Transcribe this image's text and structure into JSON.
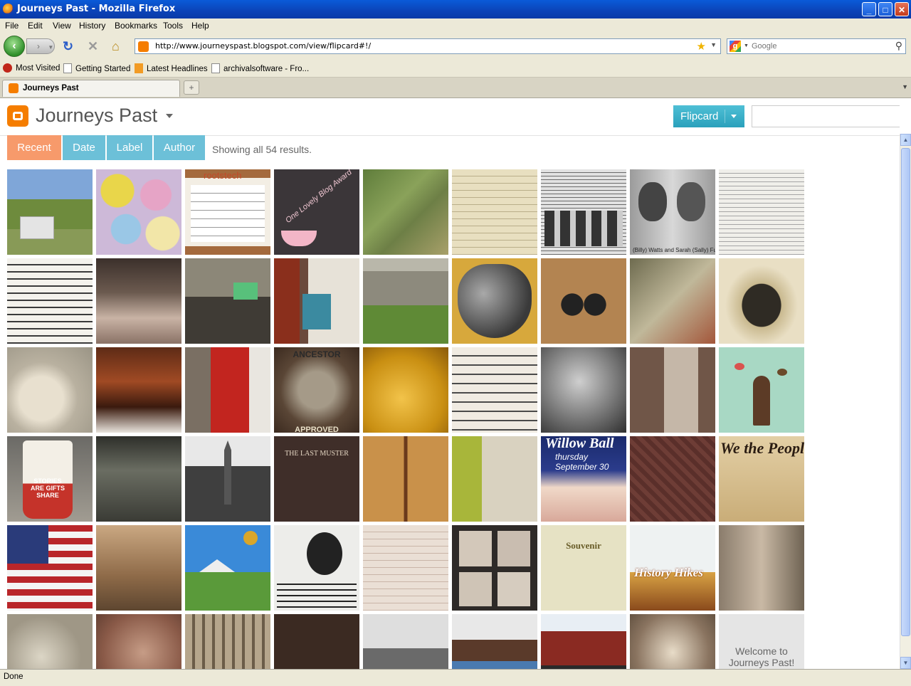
{
  "window": {
    "title": "Journeys Past - Mozilla Firefox"
  },
  "menu": [
    "File",
    "Edit",
    "View",
    "History",
    "Bookmarks",
    "Tools",
    "Help"
  ],
  "address": {
    "url": "http://www.journeyspast.blogspot.com/view/flipcard#!/"
  },
  "search": {
    "placeholder": "Google"
  },
  "bookmarks": [
    "Most Visited",
    "Getting Started",
    "Latest Headlines",
    "archivalsoftware - Fro..."
  ],
  "tab": {
    "title": "Journeys Past"
  },
  "blog": {
    "title": "Journeys Past",
    "view_button": "Flipcard",
    "filters": [
      "Recent",
      "Date",
      "Label",
      "Author"
    ],
    "active_filter": "Recent",
    "result_count": "Showing all 54 results."
  },
  "tiles": {
    "caption_watts": "(Billy) Watts and Sarah (Sally) Fuller",
    "oneLovely": "One Lovely Blog Award",
    "ancestor_top": "ANCESTOR",
    "ancestor_bottom": "APPROVED",
    "last_muster": "THE LAST MUSTER",
    "willow": "Willow Ball",
    "willow_sub": "thursday September 30",
    "stories": "STORIES ARE GIFTS SHARE",
    "souvenir": "Souvenir",
    "history_hikes": "History Hikes",
    "we_the_people": "We the People",
    "rootstech": "rootstech",
    "welcome": "Welcome to Journeys Past!"
  },
  "status": {
    "text": "Done"
  },
  "colors": {
    "accent": "#f79a6b",
    "button": "#2aa0bb",
    "filter": "#6cc0d8"
  }
}
